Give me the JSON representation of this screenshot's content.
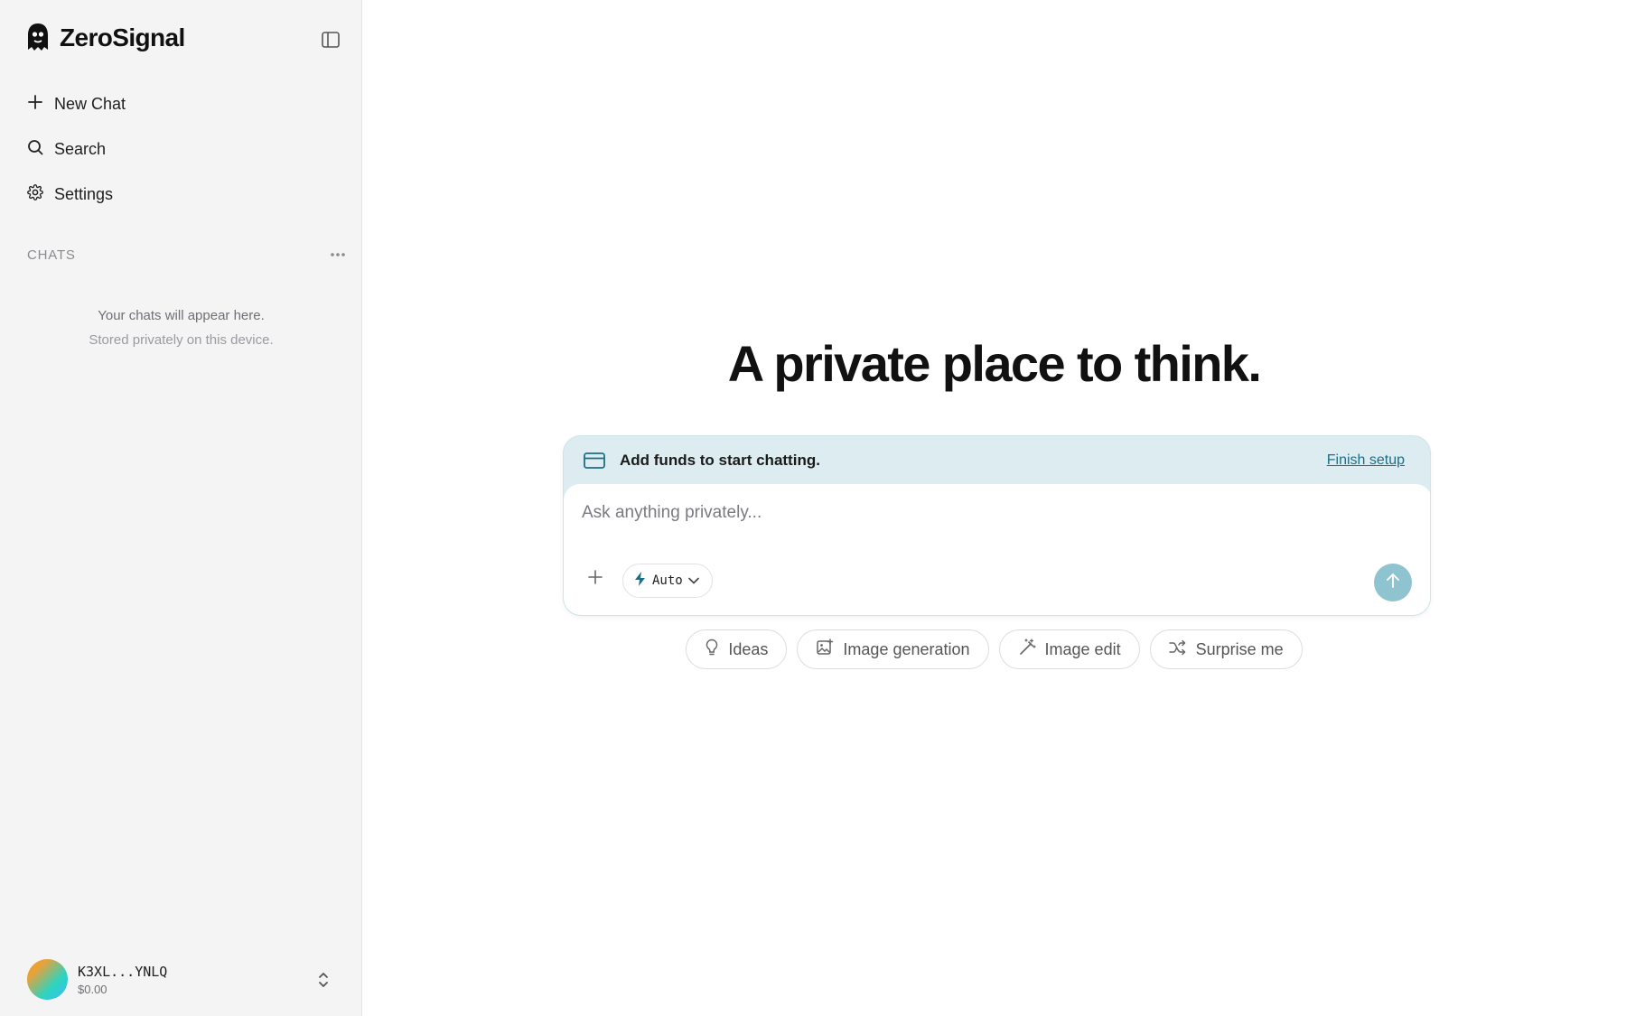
{
  "brand": {
    "name": "ZeroSignal"
  },
  "sidebar": {
    "nav": [
      {
        "label": "New Chat",
        "icon": "plus-icon"
      },
      {
        "label": "Search",
        "icon": "search-icon"
      },
      {
        "label": "Settings",
        "icon": "gear-icon"
      }
    ],
    "chats_label": "CHATS",
    "empty_line1": "Your chats will appear here.",
    "empty_line2": "Stored privately on this device.",
    "account": {
      "id": "K3XL...YNLQ",
      "balance": "$0.00"
    }
  },
  "main": {
    "headline": "A private place to think.",
    "banner": {
      "text": "Add funds to start chatting.",
      "link": "Finish setup"
    },
    "composer": {
      "placeholder": "Ask anything privately...",
      "model": "Auto"
    },
    "suggestions": [
      {
        "label": "Ideas",
        "icon": "lightbulb-icon"
      },
      {
        "label": "Image generation",
        "icon": "image-plus-icon"
      },
      {
        "label": "Image edit",
        "icon": "magic-wand-icon"
      },
      {
        "label": "Surprise me",
        "icon": "shuffle-icon"
      }
    ]
  },
  "colors": {
    "sidebar_bg": "#f4f4f5",
    "banner_bg": "#dcecf0",
    "accent": "#1b6f86",
    "send_button": "#8fc3d0"
  }
}
